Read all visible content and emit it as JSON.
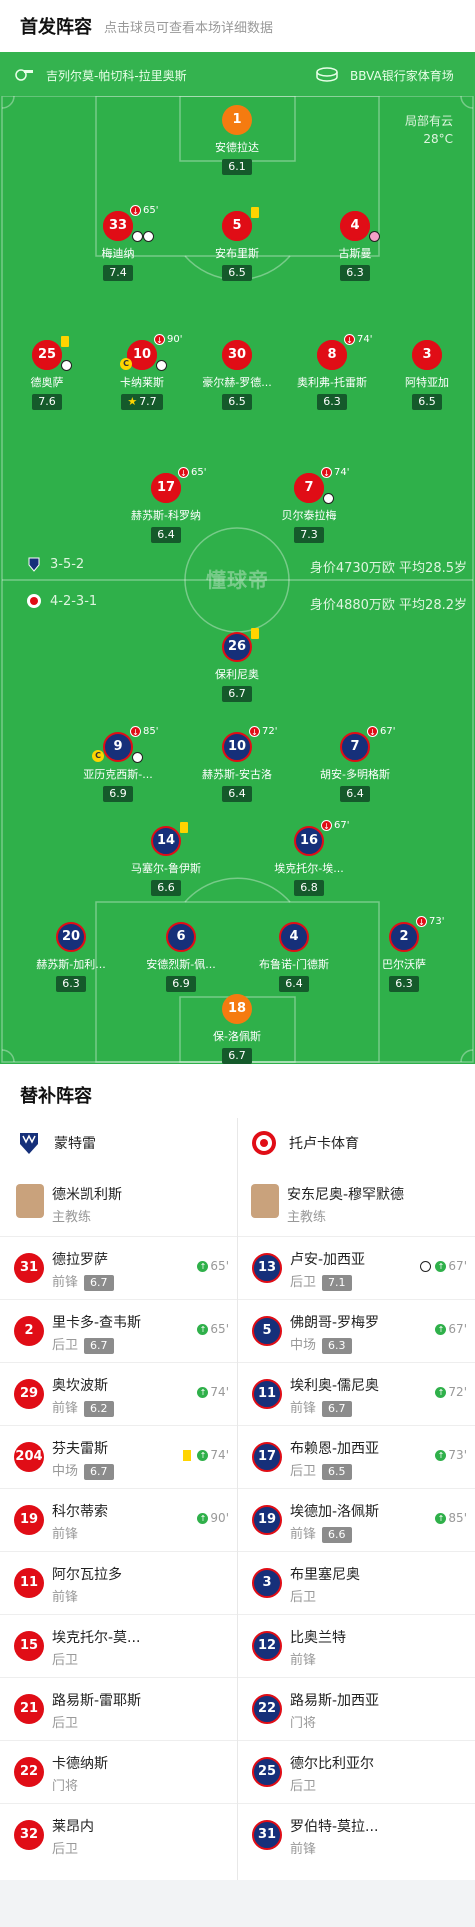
{
  "header": {
    "title": "首发阵容",
    "subtitle": "点击球员可查看本场详细数据"
  },
  "match_info": {
    "referee": "吉列尔莫-帕切科-拉里奥斯",
    "stadium": "BBVA银行家体育场",
    "weather": "局部有云",
    "temperature": "28°C"
  },
  "home_lineup": {
    "formation": "3-5-2",
    "value": "身价4730万欧 平均28.5岁",
    "players": [
      {
        "num": "1",
        "name": "安德拉达",
        "rating": "6.1",
        "color": "orange"
      },
      {
        "num": "33",
        "name": "梅迪纳",
        "rating": "7.4",
        "color": "red",
        "sub_min": "65'"
      },
      {
        "num": "5",
        "name": "安布里斯",
        "rating": "6.5",
        "color": "red"
      },
      {
        "num": "4",
        "name": "古斯曼",
        "rating": "6.3",
        "color": "red"
      },
      {
        "num": "25",
        "name": "德奥萨",
        "rating": "7.6",
        "color": "red"
      },
      {
        "num": "10",
        "name": "卡纳莱斯",
        "rating": "7.7",
        "color": "red",
        "sub_min": "90'"
      },
      {
        "num": "30",
        "name": "豪尔赫-罗德...",
        "rating": "6.5",
        "color": "red"
      },
      {
        "num": "8",
        "name": "奥利弗-托雷斯",
        "rating": "6.3",
        "color": "red",
        "sub_min": "74'"
      },
      {
        "num": "3",
        "name": "阿特亚加",
        "rating": "6.5",
        "color": "red"
      },
      {
        "num": "17",
        "name": "赫苏斯-科罗纳",
        "rating": "6.4",
        "color": "red",
        "sub_min": "65'"
      },
      {
        "num": "7",
        "name": "贝尔泰拉梅",
        "rating": "7.3",
        "color": "red",
        "sub_min": "74'"
      }
    ]
  },
  "away_lineup": {
    "formation": "4-2-3-1",
    "value": "身价4880万欧 平均28.2岁",
    "players": [
      {
        "num": "26",
        "name": "保利尼奥",
        "rating": "6.7",
        "color": "blue"
      },
      {
        "num": "9",
        "name": "亚历克西斯-...",
        "rating": "6.9",
        "color": "blue",
        "sub_min": "85'"
      },
      {
        "num": "10",
        "name": "赫苏斯-安古洛",
        "rating": "6.4",
        "color": "blue",
        "sub_min": "72'"
      },
      {
        "num": "7",
        "name": "胡安-多明格斯",
        "rating": "6.4",
        "color": "blue",
        "sub_min": "67'"
      },
      {
        "num": "14",
        "name": "马塞尔-鲁伊斯",
        "rating": "6.6",
        "color": "blue"
      },
      {
        "num": "16",
        "name": "埃克托尔-埃...",
        "rating": "6.8",
        "color": "blue",
        "sub_min": "67'"
      },
      {
        "num": "20",
        "name": "赫苏斯-加利...",
        "rating": "6.3",
        "color": "blue"
      },
      {
        "num": "6",
        "name": "安德烈斯-佩...",
        "rating": "6.9",
        "color": "blue"
      },
      {
        "num": "4",
        "name": "布鲁诺-门德斯",
        "rating": "6.4",
        "color": "blue"
      },
      {
        "num": "2",
        "name": "巴尔沃萨",
        "rating": "6.3",
        "color": "blue",
        "sub_min": "73'"
      },
      {
        "num": "18",
        "name": "保-洛佩斯",
        "rating": "6.7",
        "color": "orange"
      }
    ]
  },
  "watermark": "懂球帝",
  "subs": {
    "title": "替补阵容",
    "home": {
      "team": "蒙特雷",
      "coach_name": "德米凯利斯",
      "coach_role": "主教练",
      "players": [
        {
          "num": "31",
          "name": "德拉罗萨",
          "pos": "前锋",
          "rating": "6.7",
          "in": "65'"
        },
        {
          "num": "2",
          "name": "里卡多-查韦斯",
          "pos": "后卫",
          "rating": "6.7",
          "in": "65'"
        },
        {
          "num": "29",
          "name": "奥坎波斯",
          "pos": "前锋",
          "rating": "6.2",
          "in": "74'"
        },
        {
          "num": "204",
          "name": "芬夫雷斯",
          "pos": "中场",
          "rating": "6.7",
          "in": "74'"
        },
        {
          "num": "19",
          "name": "科尔蒂索",
          "pos": "前锋",
          "rating": "",
          "in": "90'"
        },
        {
          "num": "11",
          "name": "阿尔瓦拉多",
          "pos": "前锋",
          "rating": "",
          "in": ""
        },
        {
          "num": "15",
          "name": "埃克托尔-莫...",
          "pos": "后卫",
          "rating": "",
          "in": ""
        },
        {
          "num": "21",
          "name": "路易斯-雷耶斯",
          "pos": "后卫",
          "rating": "",
          "in": ""
        },
        {
          "num": "22",
          "name": "卡德纳斯",
          "pos": "门将",
          "rating": "",
          "in": ""
        },
        {
          "num": "32",
          "name": "莱昂内",
          "pos": "后卫",
          "rating": "",
          "in": ""
        }
      ]
    },
    "away": {
      "team": "托卢卡体育",
      "coach_name": "安东尼奥-穆罕默德",
      "coach_role": "主教练",
      "players": [
        {
          "num": "13",
          "name": "卢安-加西亚",
          "pos": "后卫",
          "rating": "7.1",
          "in": "67'"
        },
        {
          "num": "5",
          "name": "佛朗哥-罗梅罗",
          "pos": "中场",
          "rating": "6.3",
          "in": "67'"
        },
        {
          "num": "11",
          "name": "埃利奥-儒尼奥",
          "pos": "前锋",
          "rating": "6.7",
          "in": "72'"
        },
        {
          "num": "17",
          "name": "布赖恩-加西亚",
          "pos": "后卫",
          "rating": "6.5",
          "in": "73'"
        },
        {
          "num": "19",
          "name": "埃德加-洛佩斯",
          "pos": "前锋",
          "rating": "6.6",
          "in": "85'"
        },
        {
          "num": "3",
          "name": "布里塞尼奥",
          "pos": "后卫",
          "rating": "",
          "in": ""
        },
        {
          "num": "12",
          "name": "比奥兰特",
          "pos": "前锋",
          "rating": "",
          "in": ""
        },
        {
          "num": "22",
          "name": "路易斯-加西亚",
          "pos": "门将",
          "rating": "",
          "in": ""
        },
        {
          "num": "25",
          "name": "德尔比利亚尔",
          "pos": "后卫",
          "rating": "",
          "in": ""
        },
        {
          "num": "31",
          "name": "罗伯特-莫拉...",
          "pos": "前锋",
          "rating": "",
          "in": ""
        }
      ]
    }
  }
}
